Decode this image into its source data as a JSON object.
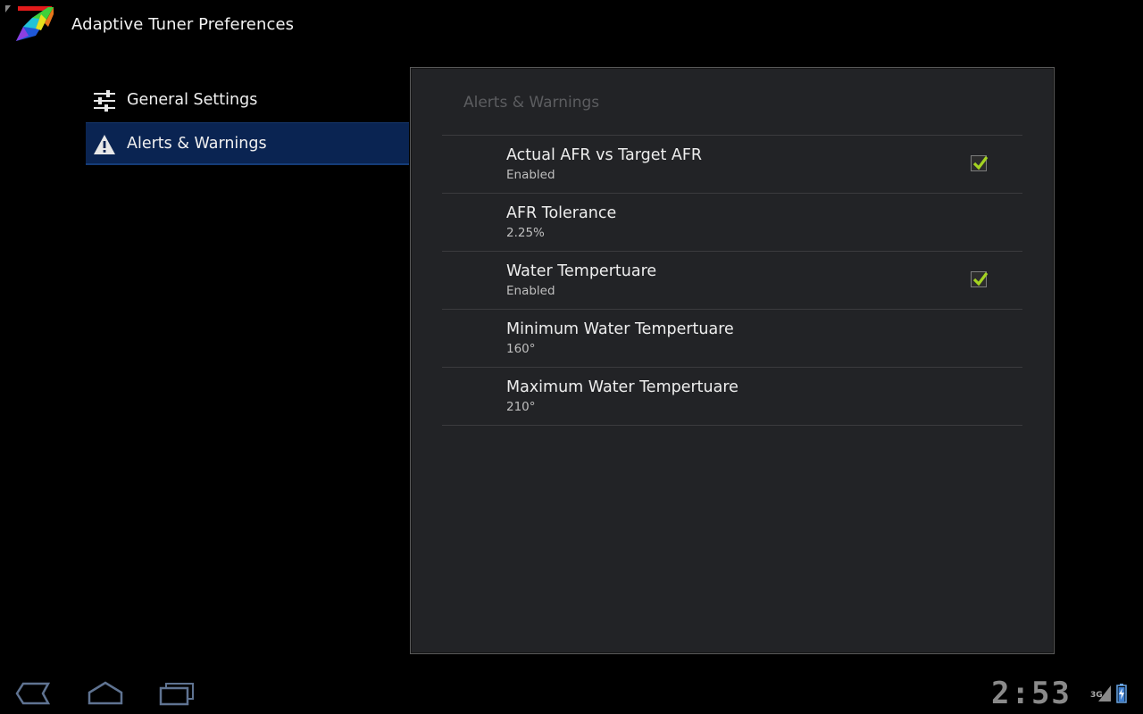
{
  "window": {
    "title": "Adaptive Tuner Preferences"
  },
  "headers": [
    {
      "label": "General Settings",
      "icon": "sliders-icon",
      "selected": false
    },
    {
      "label": "Alerts & Warnings",
      "icon": "warning-icon",
      "selected": true
    }
  ],
  "panel": {
    "title": "Alerts & Warnings",
    "prefs": [
      {
        "title": "Actual AFR vs Target AFR",
        "summary": "Enabled",
        "checkbox": true,
        "checked": true
      },
      {
        "title": "AFR Tolerance",
        "summary": "2.25%",
        "checkbox": false
      },
      {
        "title": "Water Tempertuare",
        "summary": "Enabled",
        "checkbox": true,
        "checked": true
      },
      {
        "title": "Minimum Water Tempertuare",
        "summary": "160°",
        "checkbox": false
      },
      {
        "title": "Maximum Water Tempertuare",
        "summary": "210°",
        "checkbox": false
      }
    ]
  },
  "status_bar": {
    "clock": "2:53",
    "network": "3G",
    "icons": [
      "back-icon",
      "home-icon",
      "recent-apps-icon",
      "signal-icon",
      "battery-icon"
    ]
  },
  "colors": {
    "selected_header": "#0a2452",
    "panel_bg": "#222326",
    "check_green": "#a4d321"
  }
}
